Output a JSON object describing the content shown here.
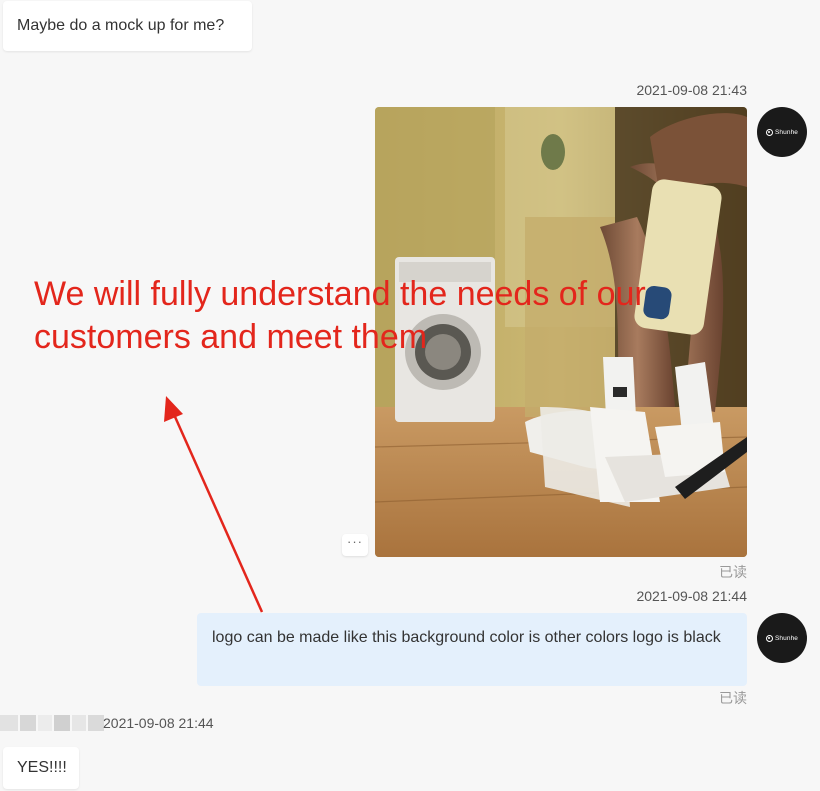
{
  "messages": {
    "incoming_1": {
      "text": "Maybe do a mock up for me?"
    },
    "outgoing_image": {
      "timestamp": "2021-09-08 21:43",
      "read_status": "已读",
      "more_label": "···"
    },
    "outgoing_text": {
      "timestamp": "2021-09-08 21:44",
      "text": "logo can be made like this background color is other colors logo is black",
      "read_status": "已读"
    },
    "incoming_2": {
      "timestamp": "2021-09-08 21:44",
      "text": "YES!!!!"
    }
  },
  "avatar": {
    "brand": "Shunhe",
    "icon": "brand-logo-icon"
  },
  "annotation": {
    "text": "We will fully understand the needs of our customers and meet them",
    "color": "#e3261c"
  },
  "colors": {
    "background": "#f7f7f7",
    "outgoing_bubble": "#e4f0fc",
    "incoming_bubble": "#ffffff",
    "annotation_red": "#e3261c"
  }
}
